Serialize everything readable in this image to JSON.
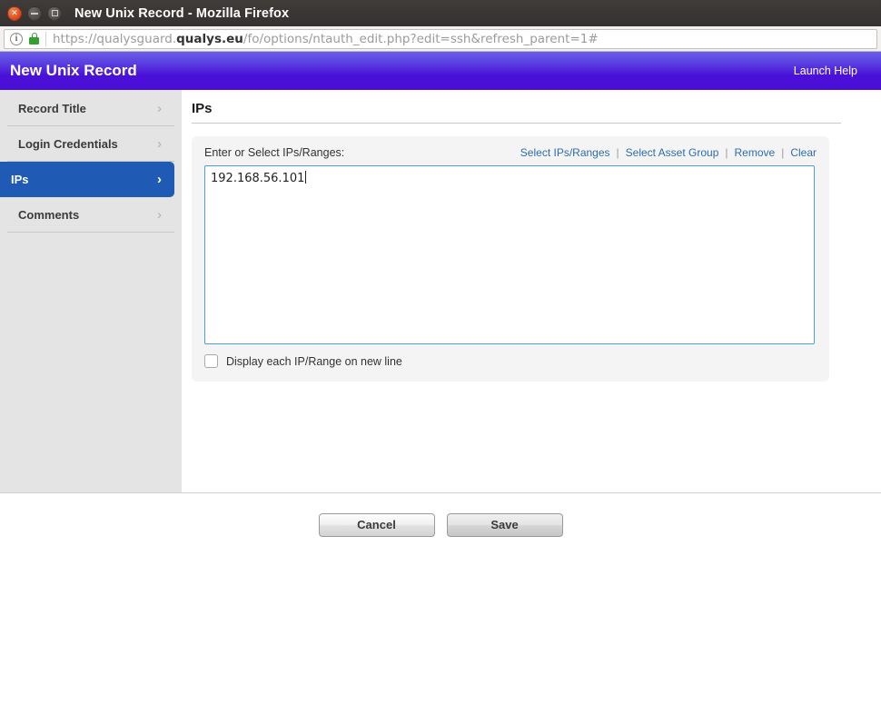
{
  "window": {
    "title": "New Unix Record - Mozilla Firefox",
    "controls": {
      "close": "close-icon",
      "minimize": "minimize-icon",
      "maximize": "maximize-icon"
    }
  },
  "browser": {
    "url_prefix": "https://qualysguard.",
    "url_domain": "qualys.eu",
    "url_suffix": "/fo/options/ntauth_edit.php?edit=ssh&refresh_parent=1#",
    "info_icon": "info-icon",
    "lock_icon": "lock-icon"
  },
  "app_header": {
    "title": "New Unix Record",
    "help_link": "Launch Help",
    "accent_color": "#4a10d8"
  },
  "sidebar": {
    "items": [
      {
        "label": "Record Title",
        "active": false,
        "chevron": "›"
      },
      {
        "label": "Login Credentials",
        "active": false,
        "chevron": "›"
      },
      {
        "label": "IPs",
        "active": true,
        "chevron": "›"
      },
      {
        "label": "Comments",
        "active": false,
        "chevron": "›"
      }
    ],
    "active_color": "#1f5bb5"
  },
  "main": {
    "section_title": "IPs",
    "panel": {
      "label": "Enter or Select IPs/Ranges:",
      "links": [
        {
          "label": "Select IPs/Ranges"
        },
        {
          "label": "Select Asset Group"
        },
        {
          "label": "Remove"
        },
        {
          "label": "Clear"
        }
      ],
      "separator": "|",
      "textarea_value": "192.168.56.101",
      "textarea_placeholder": "",
      "checkbox_label": "Display each IP/Range on new line",
      "checkbox_checked": false,
      "link_color": "#2f6cb0",
      "focus_border_color": "#4a9fd4"
    }
  },
  "footer": {
    "cancel_label": "Cancel",
    "save_label": "Save"
  }
}
